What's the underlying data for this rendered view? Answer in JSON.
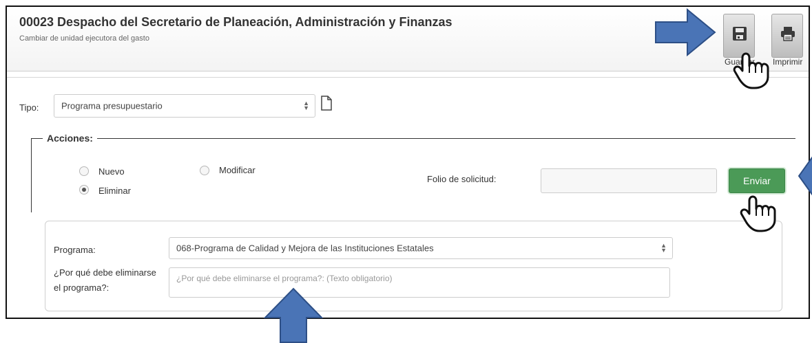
{
  "header": {
    "title": "00023 Despacho del Secretario de Planeación, Administración y Finanzas",
    "subtitle": "Cambiar de unidad ejecutora del gasto"
  },
  "toolbar": {
    "save_label": "Guardar",
    "print_label": "Imprimir"
  },
  "tipo": {
    "label": "Tipo:",
    "value": "Programa presupuestario"
  },
  "acciones": {
    "legend": "Acciones:",
    "options": [
      {
        "label": "Nuevo",
        "checked": false
      },
      {
        "label": "Modificar",
        "checked": false
      },
      {
        "label": "Eliminar",
        "checked": true
      }
    ],
    "folio_label": "Folio de solicitud:",
    "folio_value": "",
    "send_label": "Enviar"
  },
  "programa": {
    "label": "Programa:",
    "value": "068-Programa de Calidad y Mejora de las Instituciones Estatales"
  },
  "motivo": {
    "label_line1": "¿Por qué debe eliminarse",
    "label_line2": "el programa?:",
    "placeholder": "¿Por qué debe eliminarse el programa?: (Texto obligatorio)"
  },
  "colors": {
    "accent_arrow": "#4a74b6",
    "send_button": "#4b9a57"
  }
}
